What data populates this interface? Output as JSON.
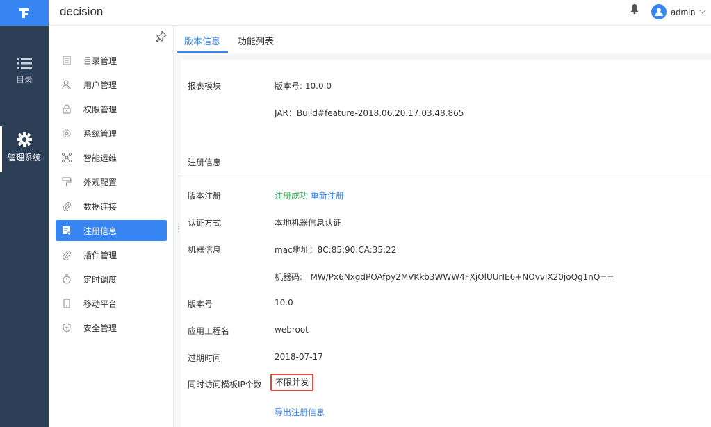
{
  "rail": {
    "items": [
      {
        "label": "目录",
        "icon": "list-icon"
      },
      {
        "label": "管理系统",
        "icon": "gear-icon",
        "active": true
      }
    ]
  },
  "header": {
    "title": "decision",
    "user": "admin"
  },
  "sidebar": {
    "items": [
      {
        "label": "目录管理",
        "icon": "catalog-icon"
      },
      {
        "label": "用户管理",
        "icon": "user-icon"
      },
      {
        "label": "权限管理",
        "icon": "lock-icon"
      },
      {
        "label": "系统管理",
        "icon": "settings-icon"
      },
      {
        "label": "智能运维",
        "icon": "network-icon"
      },
      {
        "label": "外观配置",
        "icon": "paint-roller-icon"
      },
      {
        "label": "数据连接",
        "icon": "paperclip-icon"
      },
      {
        "label": "注册信息",
        "icon": "register-icon",
        "active": true
      },
      {
        "label": "插件管理",
        "icon": "plugin-icon"
      },
      {
        "label": "定时调度",
        "icon": "timer-icon"
      },
      {
        "label": "移动平台",
        "icon": "mobile-icon"
      },
      {
        "label": "安全管理",
        "icon": "shield-icon"
      }
    ]
  },
  "tabs": [
    {
      "label": "版本信息",
      "active": true
    },
    {
      "label": "功能列表"
    }
  ],
  "version": {
    "module_label": "报表模块",
    "version_text": "版本号: 10.0.0",
    "jar_text": "JAR：Build#feature-2018.06.20.17.03.48.865"
  },
  "registration": {
    "section_title": "注册信息",
    "rows": {
      "reg_label": "版本注册",
      "reg_status": "注册成功",
      "reg_again": "重新注册",
      "auth_label": "认证方式",
      "auth_value": "本地机器信息认证",
      "machine_label": "机器信息",
      "mac_text": "mac地址：8C:85:90:CA:35:22",
      "code_text": "机器码:   MW/Px6NxgdPOAfpy2MVKkb3WWW4FXjOlUUrIE6+NOvvIX20joQg1nQ==",
      "ver_label": "版本号",
      "ver_value": "10.0",
      "app_label": "应用工程名",
      "app_value": "webroot",
      "expire_label": "过期时间",
      "expire_value": "2018-07-17",
      "concurrent_label": "同时访问模板IP个数",
      "concurrent_value": "不限并发",
      "export_link": "导出注册信息"
    }
  },
  "colors": {
    "accent": "#3685f2",
    "rail_bg": "#2d3e57",
    "success": "#38b05b",
    "highlight_border": "#e0473f"
  }
}
